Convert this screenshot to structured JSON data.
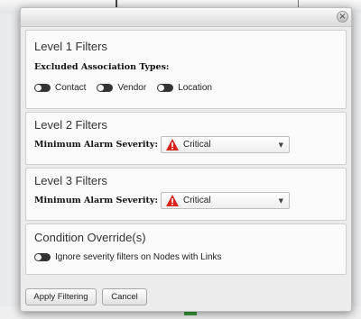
{
  "dialog": {
    "close_glyph": "×"
  },
  "level1": {
    "title": "Level 1 Filters",
    "label": "Excluded Association Types:",
    "toggles": [
      "Contact",
      "Vendor",
      "Location"
    ]
  },
  "level2": {
    "title": "Level 2 Filters",
    "label": "Minimum Alarm Severity:",
    "value": "Critical"
  },
  "level3": {
    "title": "Level 3 Filters",
    "label": "Minimum Alarm Severity:",
    "value": "Critical"
  },
  "override": {
    "title": "Condition Override(s)",
    "toggle_label": "Ignore severity filters on Nodes with Links"
  },
  "buttons": {
    "apply": "Apply Filtering",
    "cancel": "Cancel"
  },
  "icons": {
    "severity": "warning-triangle-icon",
    "dropdown": "chevron-down-icon",
    "close": "close-icon"
  },
  "colors": {
    "critical": "#d9241c",
    "toggle_off": "#333333"
  }
}
